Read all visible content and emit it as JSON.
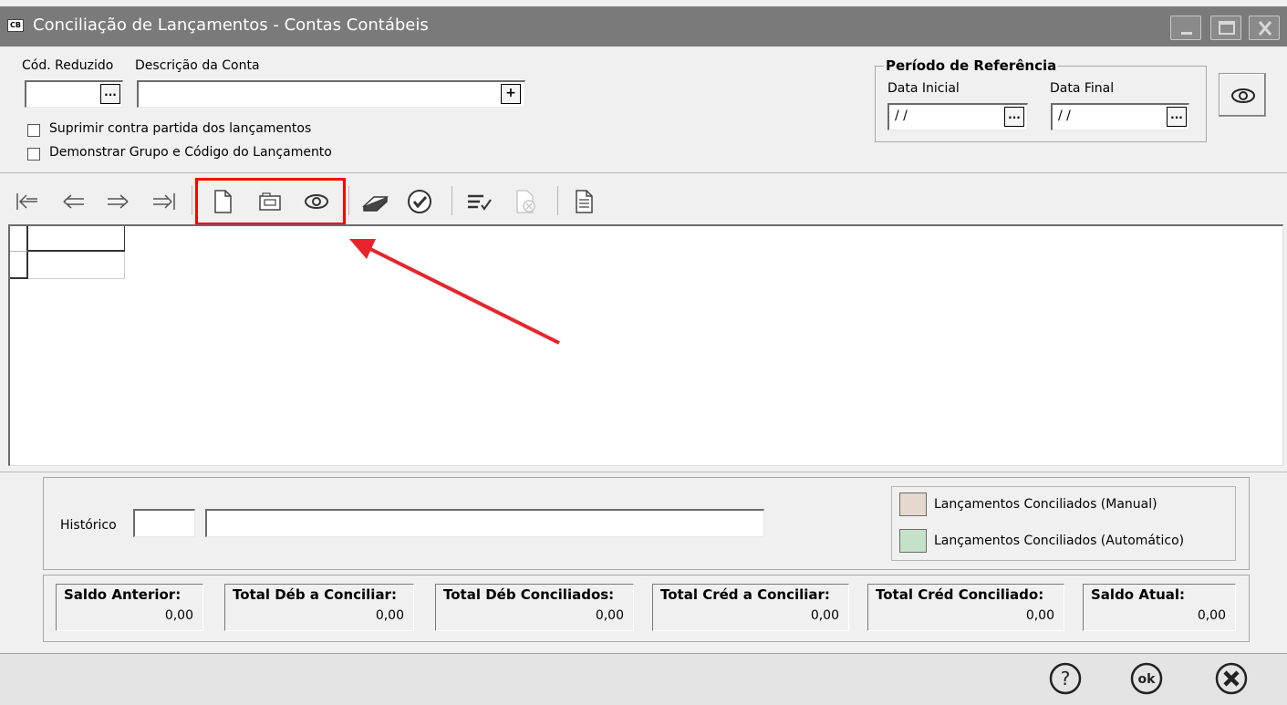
{
  "window": {
    "app_badge": "CB",
    "title": "Conciliação de Lançamentos - Contas Contábeis"
  },
  "filters": {
    "cod_reduzido_label": "Cód. Reduzido",
    "descricao_label": "Descrição da Conta",
    "cod_reduzido_value": "",
    "descricao_value": "",
    "lookup_glyph": "...",
    "expand_glyph": "+",
    "suprimir_label": "Suprimir contra partida dos lançamentos",
    "suprimir_checked": false,
    "demonstrar_label": "Demonstrar Grupo e Código do Lançamento",
    "demonstrar_checked": false
  },
  "periodo": {
    "title": "Período de Referência",
    "data_inicial_label": "Data Inicial",
    "data_final_label": "Data Final",
    "data_inicial_value": "/ /",
    "data_final_value": "/ /"
  },
  "toolbar": {
    "icons": [
      "first-icon",
      "previous-icon",
      "next-icon",
      "last-icon",
      "new-document-icon",
      "edit-folder-icon",
      "view-eye-icon",
      "eraser-icon",
      "check-circle-icon",
      "reconcile-list-icon",
      "cancel-reconcile-icon",
      "report-icon"
    ]
  },
  "historico": {
    "label": "Histórico",
    "code_value": "",
    "text_value": ""
  },
  "legend": {
    "manual_label": "Lançamentos Conciliados (Manual)",
    "manual_color": "#e6d8cc",
    "auto_label": "Lançamentos Conciliados (Automático)",
    "auto_color": "#c4e2c7"
  },
  "totals": [
    {
      "label": "Saldo Anterior:",
      "value": "0,00"
    },
    {
      "label": "Total Déb a Conciliar:",
      "value": "0,00"
    },
    {
      "label": "Total Déb Conciliados:",
      "value": "0,00"
    },
    {
      "label": "Total Créd a Conciliar:",
      "value": "0,00"
    },
    {
      "label": "Total Créd Conciliado:",
      "value": "0,00"
    },
    {
      "label": "Saldo Atual:",
      "value": "0,00"
    }
  ],
  "footer": {
    "ok_label": "ok"
  },
  "colors": {
    "titlebar": "#7a7a7a",
    "highlight": "#ff0000",
    "arrow": "#e8242a"
  }
}
